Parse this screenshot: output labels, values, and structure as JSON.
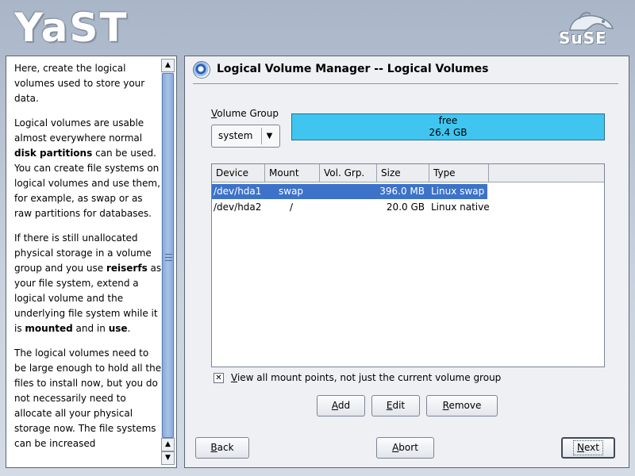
{
  "header": {
    "yast_logo": "YaST",
    "suse_logo": "SuSE"
  },
  "help": {
    "paragraphs": [
      [
        {
          "t": "Here, create the logical volumes used to store your data.",
          "b": false
        }
      ],
      [
        {
          "t": "Logical volumes are usable almost everywhere normal ",
          "b": false
        },
        {
          "t": "disk partitions",
          "b": true
        },
        {
          "t": " can be used. You can create file systems on logical volumes and use them, for example, as swap or as raw partitions for databases.",
          "b": false
        }
      ],
      [
        {
          "t": "If there is still unallocated physical storage in a volume group and you use ",
          "b": false
        },
        {
          "t": "reiserfs",
          "b": true
        },
        {
          "t": " as your file system, extend a logical volume and the underlying file system while it is ",
          "b": false
        },
        {
          "t": "mounted",
          "b": true
        },
        {
          "t": " and in ",
          "b": false
        },
        {
          "t": "use",
          "b": true
        },
        {
          "t": ".",
          "b": false
        }
      ],
      [
        {
          "t": "The logical volumes need to be large enough to hold all the files to install now, but you do not necessarily need to allocate all your physical storage now. The file systems can be increased",
          "b": false
        }
      ]
    ],
    "scroll_up": "▲",
    "scroll_down": "▼"
  },
  "dialog": {
    "title": "Logical Volume Manager -- Logical Volumes",
    "volume_group_label": "Volume Group",
    "volume_group_value": "system",
    "free_label": "free",
    "free_value": "26.4 GB",
    "table": {
      "headers": [
        "Device",
        "Mount",
        "Vol. Grp.",
        "Size",
        "Type"
      ],
      "rows": [
        {
          "device": "/dev/hda1",
          "mount": "swap",
          "vg": "",
          "size": "396.0 MB",
          "type": "Linux swap",
          "selected": true
        },
        {
          "device": "/dev/hda2",
          "mount": "/",
          "vg": "",
          "size": "20.0 GB",
          "type": "Linux native",
          "selected": false
        }
      ]
    },
    "view_all_checked": true,
    "view_all_label": "View all mount points, not just the current volume group",
    "buttons": {
      "add": "Add",
      "edit": "Edit",
      "remove": "Remove"
    }
  },
  "nav": {
    "back": "Back",
    "abort": "Abort",
    "next": "Next"
  }
}
